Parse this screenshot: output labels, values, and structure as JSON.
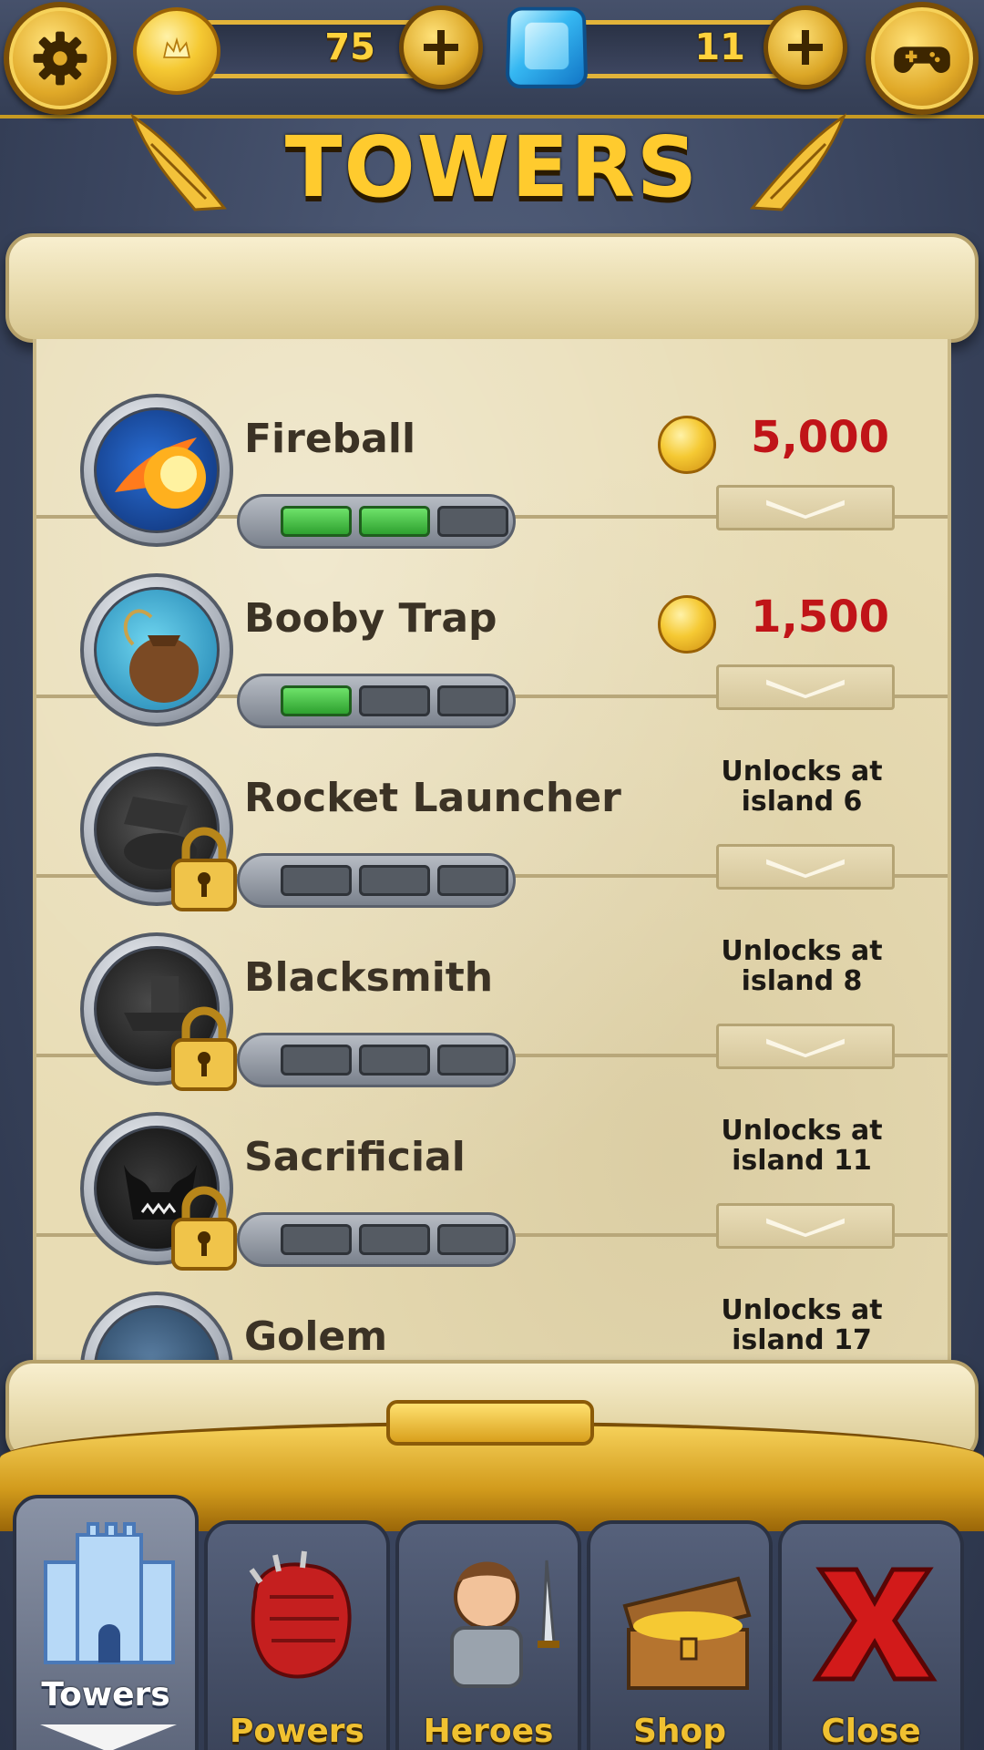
{
  "header": {
    "coins": "75",
    "gems": "11",
    "title": "TOWERS"
  },
  "towers": [
    {
      "name": "Fireball",
      "price": "5,000",
      "level": 2,
      "max_level": 3,
      "locked": false,
      "unlock_text": ""
    },
    {
      "name": "Booby Trap",
      "price": "1,500",
      "level": 1,
      "max_level": 3,
      "locked": false,
      "unlock_text": ""
    },
    {
      "name": "Rocket Launcher",
      "price": "",
      "level": 0,
      "max_level": 3,
      "locked": true,
      "unlock_text": "Unlocks at island 6"
    },
    {
      "name": "Blacksmith",
      "price": "",
      "level": 0,
      "max_level": 3,
      "locked": true,
      "unlock_text": "Unlocks at island 8"
    },
    {
      "name": "Sacrificial",
      "price": "",
      "level": 0,
      "max_level": 3,
      "locked": true,
      "unlock_text": "Unlocks at island 11"
    },
    {
      "name": "Golem",
      "price": "",
      "level": 0,
      "max_level": 3,
      "locked": true,
      "unlock_text": "Unlocks at island 17"
    }
  ],
  "nav": [
    {
      "label": "Towers",
      "icon": "castle-icon",
      "active": true
    },
    {
      "label": "Powers",
      "icon": "fist-icon",
      "active": false
    },
    {
      "label": "Heroes",
      "icon": "hero-icon",
      "active": false
    },
    {
      "label": "Shop",
      "icon": "treasure-chest-icon",
      "active": false
    },
    {
      "label": "Close",
      "icon": "close-x-icon",
      "active": false
    }
  ],
  "colors": {
    "gold": "#ffcb2e",
    "price_red": "#c01418",
    "progress_green": "#3fbf3d",
    "parchment": "#e8dcb4"
  }
}
